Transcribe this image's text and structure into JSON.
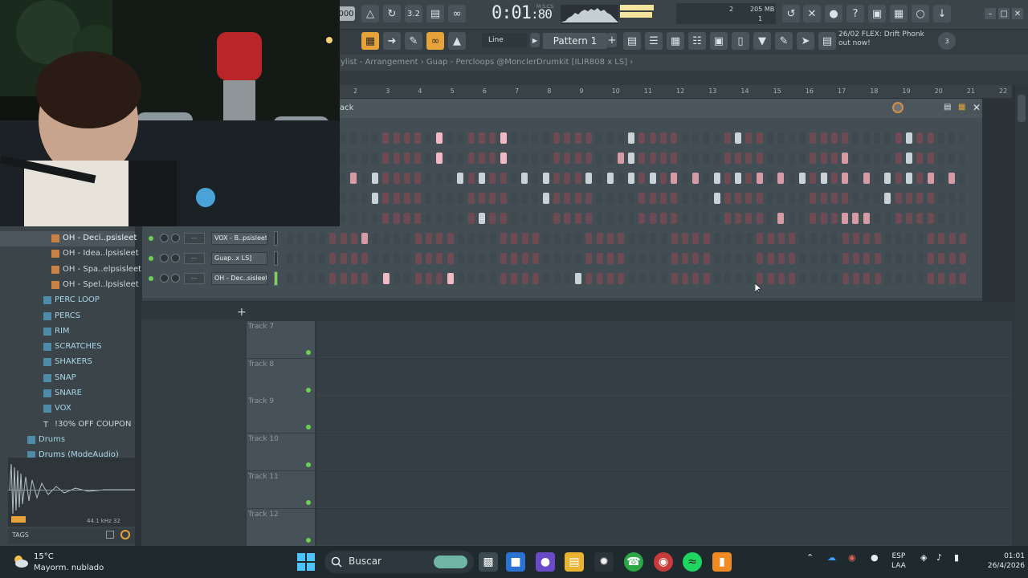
{
  "toolbar": {
    "tempo_value": "000",
    "time": "0:01",
    "time_frac": "80",
    "time_unit": "M:S:CS",
    "cpu_value": "2",
    "memory": "205 MB",
    "poly": "1",
    "snap": "Line",
    "pattern": "Pattern 1",
    "news_line1": "26/02  FLEX: Drift Phonk",
    "news_line2": "out now!",
    "news_badge": "3"
  },
  "playlist": {
    "title": "ylist - Arrangement › Guap - Percloops @MonclerDrumkit [ILIR808 x LS] ›",
    "ruler": [
      "2",
      "3",
      "4",
      "5",
      "6",
      "7",
      "8",
      "9",
      "10",
      "11",
      "12",
      "13",
      "14",
      "15",
      "16",
      "17",
      "18",
      "19",
      "20",
      "21",
      "22"
    ],
    "tracks": [
      "Track 7",
      "Track 8",
      "Track 9",
      "Track 10",
      "Track 11",
      "Track 12"
    ]
  },
  "rack": {
    "title": "ack",
    "rows": [
      {
        "name": "VOX - B..psisleet",
        "num": "---"
      },
      {
        "name": "Guap..x LS]",
        "num": "---"
      },
      {
        "name": "OH - Dec..sisleet",
        "num": "---"
      }
    ]
  },
  "browser": {
    "items": [
      {
        "label": "OH - Deci..psisleet",
        "type": "file",
        "selected": true
      },
      {
        "label": "OH - Idea..lpsisleet",
        "type": "file"
      },
      {
        "label": "OH - Spa..elpsisleet",
        "type": "file"
      },
      {
        "label": "OH - Spel..lpsisleet",
        "type": "file"
      },
      {
        "label": "PERC LOOP",
        "type": "folder"
      },
      {
        "label": "PERCS",
        "type": "folder"
      },
      {
        "label": "RIM",
        "type": "folder"
      },
      {
        "label": "SCRATCHES",
        "type": "folder"
      },
      {
        "label": "SHAKERS",
        "type": "folder"
      },
      {
        "label": "SNAP",
        "type": "folder"
      },
      {
        "label": "SNARE",
        "type": "folder"
      },
      {
        "label": "VOX",
        "type": "folder"
      },
      {
        "label": "!30% OFF COUPON",
        "type": "text"
      },
      {
        "label": "Drums",
        "type": "folder"
      },
      {
        "label": "Drums (ModeAudio)",
        "type": "folder"
      }
    ],
    "freq": "44.1 kHz 32",
    "tags": "TAGS"
  },
  "taskbar": {
    "temperature": "15°C",
    "condition": "Mayorm. nublado",
    "search": "Buscar",
    "lang1": "ESP",
    "lang2": "LAA",
    "time": "01:01",
    "date": "26/4/2026"
  },
  "colors": {
    "accent_green": "#6bd154",
    "step_red": "#d69aa5",
    "step_grey": "#c9d2d6",
    "folder": "#4d8ba9",
    "audio": "#c98246"
  }
}
